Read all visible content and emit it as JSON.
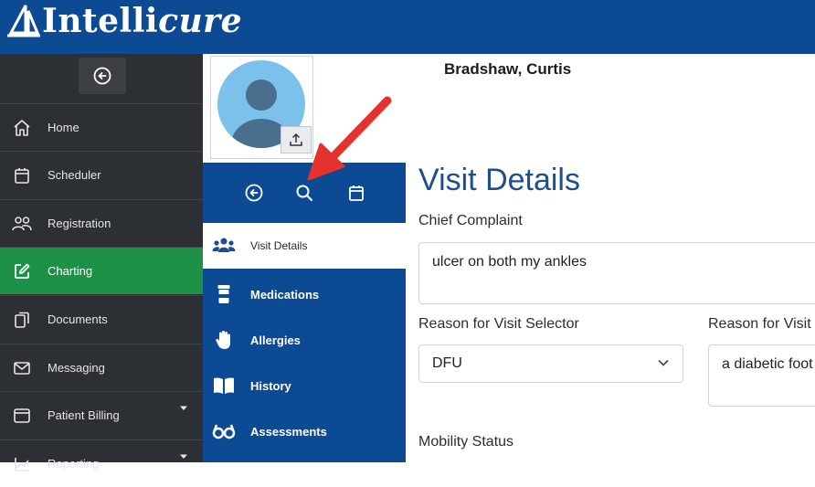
{
  "app": {
    "logo_prefix": "Intelli",
    "logo_suffix": "cure"
  },
  "sidebar": {
    "items": [
      {
        "label": "Home",
        "icon": "home-icon"
      },
      {
        "label": "Scheduler",
        "icon": "calendar-icon"
      },
      {
        "label": "Registration",
        "icon": "users-icon"
      },
      {
        "label": "Charting",
        "icon": "edit-icon",
        "active": true
      },
      {
        "label": "Documents",
        "icon": "documents-icon"
      },
      {
        "label": "Messaging",
        "icon": "mail-icon"
      },
      {
        "label": "Patient Billing",
        "icon": "wallet-icon"
      },
      {
        "label": "Reporting",
        "icon": "chart-icon"
      }
    ]
  },
  "patient": {
    "name": "Bradshaw, Curtis"
  },
  "subnav": {
    "items": [
      {
        "label": "Visit Details",
        "icon": "group-icon",
        "active": true
      },
      {
        "label": "Medications",
        "icon": "pill-bottle-icon"
      },
      {
        "label": "Allergies",
        "icon": "hand-icon"
      },
      {
        "label": "History",
        "icon": "book-icon"
      },
      {
        "label": "Assessments",
        "icon": "glasses-icon"
      }
    ]
  },
  "visit": {
    "title": "Visit Details",
    "chief_complaint_label": "Chief Complaint",
    "chief_complaint_value": "ulcer on both my ankles",
    "reason_selector_label": "Reason for Visit Selector",
    "reason_selector_value": "DFU",
    "reason_label": "Reason for Visit",
    "reason_value": "a diabetic foot",
    "mobility_label": "Mobility Status"
  },
  "colors": {
    "header_blue": "#0d4a94",
    "sidebar_dark": "#2c2f33",
    "active_green": "#1e9148",
    "title_blue": "#1d4f8f",
    "annotation_red": "#e5322d"
  }
}
